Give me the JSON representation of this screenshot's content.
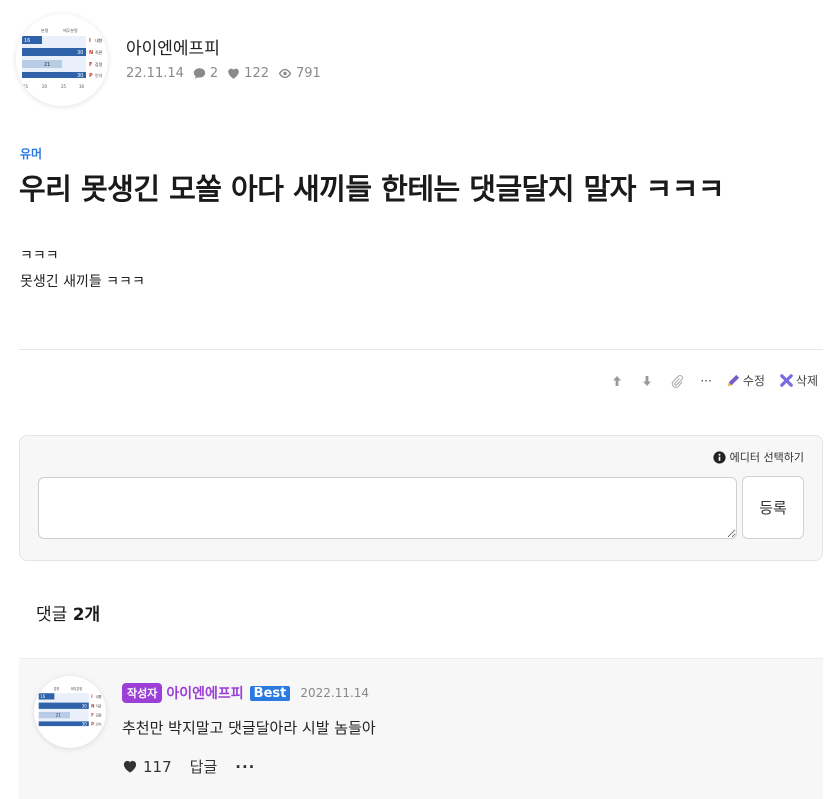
{
  "post": {
    "author": "아이엔에프피",
    "date": "22.11.14",
    "comment_count": "2",
    "like_count": "122",
    "view_count": "791",
    "category": "유머",
    "title": "우리 못생긴 모쏠 아다 새끼들 한테는 댓글달지 말자 ㅋㅋㅋ",
    "body": [
      "ㅋㅋㅋ",
      "못생긴 새끼들 ㅋㅋㅋ"
    ]
  },
  "avatar_chart": {
    "headers": [
      "분명",
      "애무분명"
    ],
    "rows": [
      {
        "letter": "I",
        "word": "내향",
        "value": "16"
      },
      {
        "letter": "N",
        "word": "직관",
        "value": "30"
      },
      {
        "letter": "F",
        "word": "감정",
        "value": "21"
      },
      {
        "letter": "P",
        "word": "인식",
        "value": "30"
      }
    ],
    "ticks": [
      "15",
      "20",
      "25",
      "30"
    ]
  },
  "actions": {
    "up_icon": "arrow-up-icon",
    "down_icon": "arrow-down-icon",
    "attach_icon": "paperclip-icon",
    "more_label": "···",
    "edit_label": "수정",
    "delete_label": "삭제"
  },
  "comment_form": {
    "editor_select_label": "에디터 선택하기",
    "input_value": "",
    "submit_label": "등록"
  },
  "comments": {
    "heading_prefix": "댓글",
    "heading_count": "2개",
    "items": [
      {
        "badge": "작성자",
        "author": "아이엔에프피",
        "best_label": "Best",
        "date": "2022.11.14",
        "text": "추천만 박지말고 댓글달아라 시발 놈들아",
        "like_count": "117",
        "reply_label": "답글",
        "more_label": "···"
      }
    ]
  },
  "colors": {
    "accent_blue": "#2a7ae2",
    "author_purple": "#9b3fd6",
    "muted": "#8a8a8a"
  }
}
